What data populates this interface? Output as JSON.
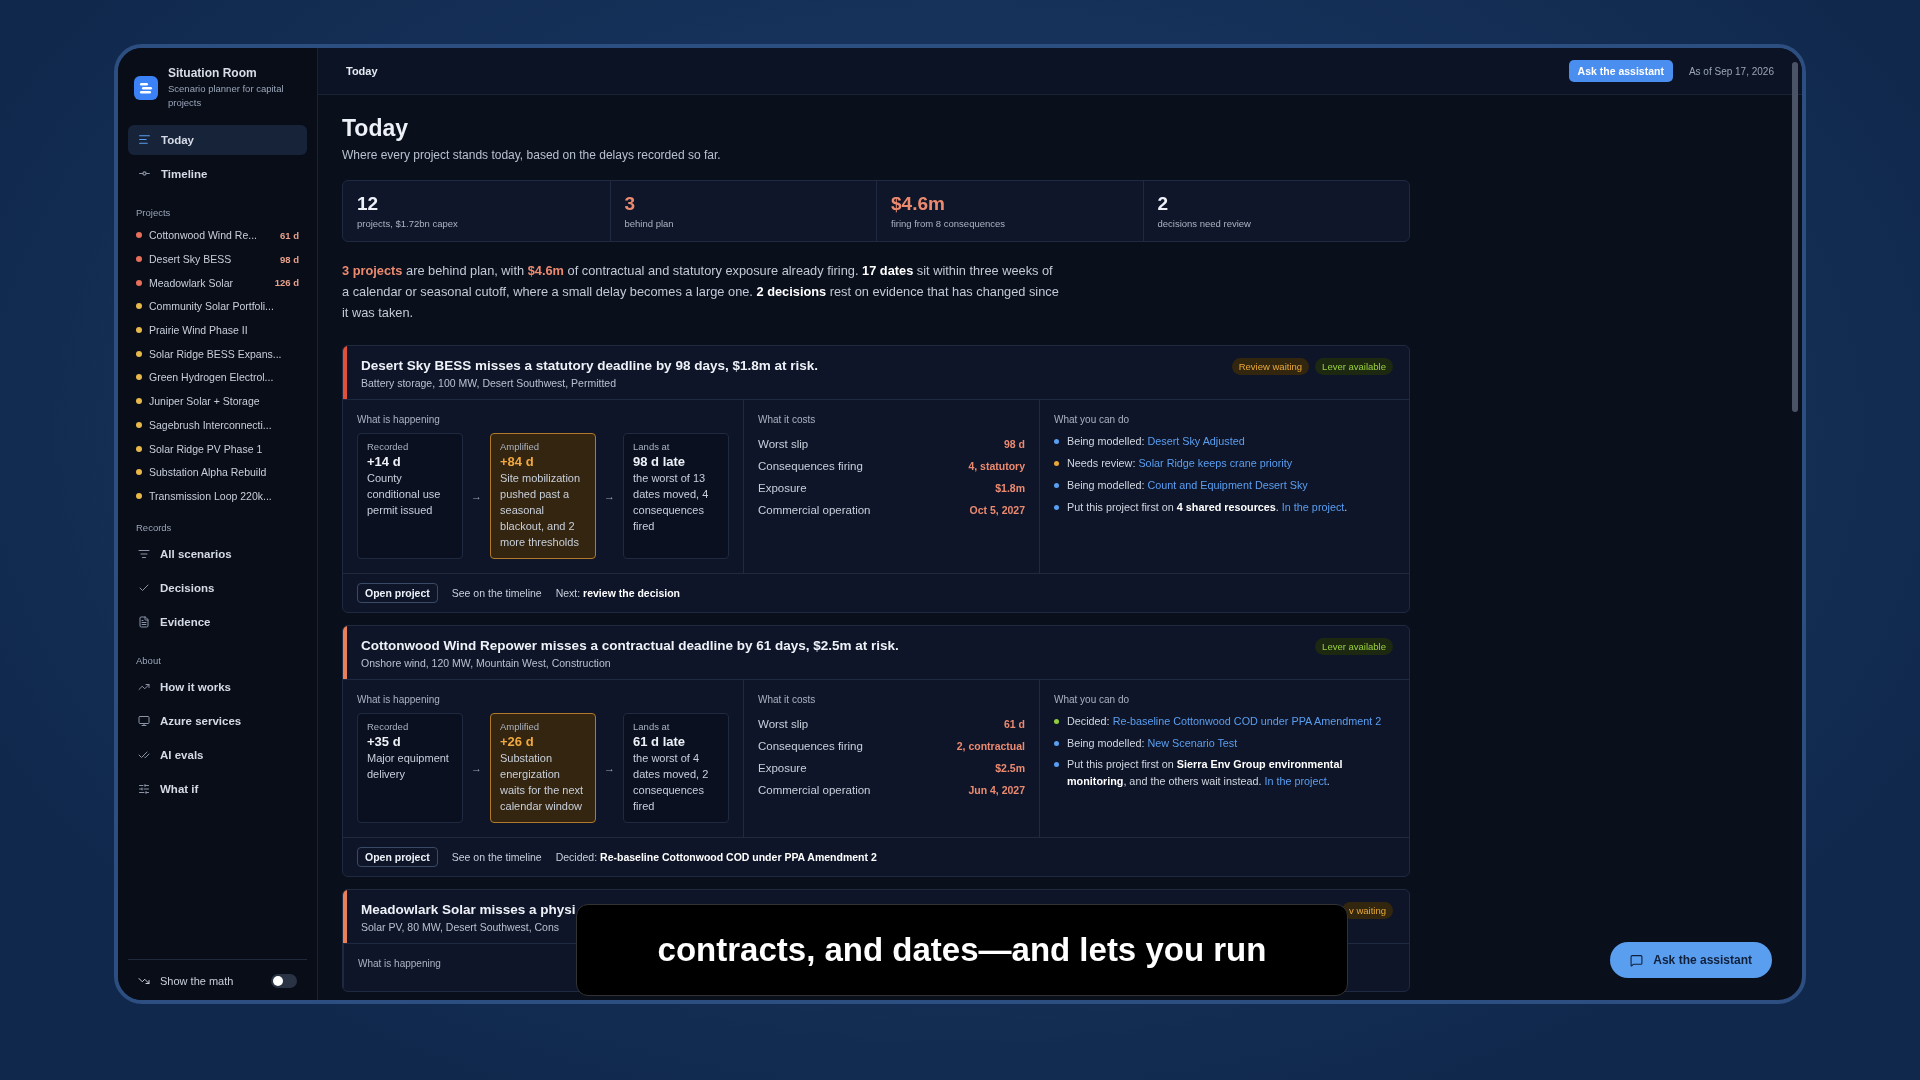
{
  "sidebar": {
    "brand": {
      "title": "Situation Room",
      "subtitle": "Scenario planner for capital projects"
    },
    "nav": [
      {
        "label": "Today",
        "selected": true
      },
      {
        "label": "Timeline",
        "selected": false
      }
    ],
    "groups": [
      {
        "heading": "Projects",
        "projects": [
          {
            "name": "Cottonwood Wind Re...",
            "days": "61 d",
            "color": "#e8705a"
          },
          {
            "name": "Desert Sky BESS",
            "days": "98 d",
            "color": "#e8705a"
          },
          {
            "name": "Meadowlark Solar",
            "days": "126 d",
            "color": "#e8705a"
          },
          {
            "name": "Community Solar Portfoli...",
            "color": "#e8b84a"
          },
          {
            "name": "Prairie Wind Phase II",
            "color": "#e8b84a"
          },
          {
            "name": "Solar Ridge BESS Expans...",
            "color": "#e8b84a"
          },
          {
            "name": "Green Hydrogen Electrol...",
            "color": "#e8b84a"
          },
          {
            "name": "Juniper Solar + Storage",
            "color": "#e8b84a"
          },
          {
            "name": "Sagebrush Interconnecti...",
            "color": "#e8b84a"
          },
          {
            "name": "Solar Ridge PV Phase 1",
            "color": "#e8b84a"
          },
          {
            "name": "Substation Alpha Rebuild",
            "color": "#e8b84a"
          },
          {
            "name": "Transmission Loop 220k...",
            "color": "#e8b84a"
          }
        ]
      },
      {
        "heading": "Records",
        "links": [
          "All scenarios",
          "Decisions",
          "Evidence"
        ]
      },
      {
        "heading": "About",
        "links": [
          "How it works",
          "Azure services",
          "AI evals",
          "What if"
        ]
      }
    ],
    "toggle": {
      "label": "Show the math",
      "on": false
    }
  },
  "topbar": {
    "title": "Today",
    "button": "Ask the assistant",
    "as_of": "As of Sep 17, 2026"
  },
  "heading": "Today",
  "subtitle": "Where every project stands today, based on the delays recorded so far.",
  "stats": [
    {
      "value": "12",
      "label": "projects, $1.72bn capex",
      "kind": "plain"
    },
    {
      "value": "3",
      "label": "behind plan",
      "kind": "alert"
    },
    {
      "value": "$4.6m",
      "label": "firing from 8 consequences",
      "kind": "alert"
    },
    {
      "value": "2",
      "label": "decisions need review",
      "kind": "plain"
    }
  ],
  "summary": [
    {
      "text": "3 projects",
      "kind": "alert"
    },
    {
      "text": " are behind plan, with ",
      "kind": "plain"
    },
    {
      "text": "$4.6m",
      "kind": "alert"
    },
    {
      "text": " of contractual and statutory exposure already firing. ",
      "kind": "plain"
    },
    {
      "text": "17 dates",
      "kind": "strong"
    },
    {
      "text": " sit within three weeks of a calendar or seasonal cutoff, where a small delay becomes a large one. ",
      "kind": "plain"
    },
    {
      "text": "2 decisions",
      "kind": "strong"
    },
    {
      "text": " rest on evidence that has changed since it was taken.",
      "kind": "plain"
    }
  ],
  "cards": [
    {
      "title": "Desert Sky BESS misses a statutory deadline by 98 days, $1.8m at risk.",
      "subtitle": "Battery storage, 100 MW, Desert Southwest, Permitted",
      "color": "#e0503a",
      "badges": [
        {
          "label": "Review waiting",
          "kind": "review"
        },
        {
          "label": "Lever available",
          "kind": "lever"
        }
      ],
      "happening": {
        "heading": "What is happening",
        "steps": [
          {
            "label": "Recorded",
            "value": "+14 d",
            "text": "County conditional use permit issued",
            "kind": "plain"
          },
          {
            "label": "Amplified",
            "value": "+84 d",
            "text": "Site mobilization pushed past a seasonal blackout, and 2 more thresholds",
            "kind": "amplified"
          },
          {
            "label": "Lands at",
            "value": "98 d late",
            "text": "the worst of 13 dates moved, 4 consequences fired",
            "kind": "plain"
          }
        ],
        "arrows": [
          "→",
          "→"
        ]
      },
      "costs": {
        "heading": "What it costs",
        "rows": [
          {
            "label": "Worst slip",
            "value": "98 d"
          },
          {
            "label": "Consequences firing",
            "value": "4, statutory"
          },
          {
            "label": "Exposure",
            "value": "$1.8m"
          },
          {
            "label": "Commercial operation",
            "value": "Oct 5, 2027"
          }
        ]
      },
      "actions": {
        "heading": "What you can do",
        "items": [
          {
            "color": "#5a9ef0",
            "parts": [
              {
                "text": "Being modelled: ",
                "kind": "plain"
              },
              {
                "text": "Desert Sky Adjusted",
                "kind": "link"
              }
            ]
          },
          {
            "color": "#e8a838",
            "parts": [
              {
                "text": "Needs review: ",
                "kind": "plain"
              },
              {
                "text": "Solar Ridge keeps crane priority",
                "kind": "link"
              }
            ]
          },
          {
            "color": "#5a9ef0",
            "parts": [
              {
                "text": "Being modelled: ",
                "kind": "plain"
              },
              {
                "text": "Count and Equipment Desert Sky",
                "kind": "link"
              }
            ]
          },
          {
            "color": "#5a9ef0",
            "parts": [
              {
                "text": "Put this project first on ",
                "kind": "plain"
              },
              {
                "text": "4 shared resources",
                "kind": "strong"
              },
              {
                "text": ". ",
                "kind": "plain"
              },
              {
                "text": "In the project",
                "kind": "link"
              },
              {
                "text": ".",
                "kind": "plain"
              }
            ]
          }
        ]
      },
      "footer": {
        "button": "Open project",
        "link": "See on the timeline",
        "note_label": "Next:",
        "note_value": "review the decision"
      }
    },
    {
      "title": "Cottonwood Wind Repower misses a contractual deadline by 61 days, $2.5m at risk.",
      "subtitle": "Onshore wind, 120 MW, Mountain West, Construction",
      "color": "#e8805a",
      "badges": [
        {
          "label": "Lever available",
          "kind": "lever"
        }
      ],
      "happening": {
        "heading": "What is happening",
        "steps": [
          {
            "label": "Recorded",
            "value": "+35 d",
            "text": "Major equipment delivery",
            "kind": "plain"
          },
          {
            "label": "Amplified",
            "value": "+26 d",
            "text": "Substation energization waits for the next calendar window",
            "kind": "amplified"
          },
          {
            "label": "Lands at",
            "value": "61 d late",
            "text": "the worst of 4 dates moved, 2 consequences fired",
            "kind": "plain"
          }
        ],
        "arrows": [
          "→",
          "→"
        ]
      },
      "costs": {
        "heading": "What it costs",
        "rows": [
          {
            "label": "Worst slip",
            "value": "61 d"
          },
          {
            "label": "Consequences firing",
            "value": "2, contractual"
          },
          {
            "label": "Exposure",
            "value": "$2.5m"
          },
          {
            "label": "Commercial operation",
            "value": "Jun 4, 2027"
          }
        ]
      },
      "actions": {
        "heading": "What you can do",
        "items": [
          {
            "color": "#8fcf3f",
            "parts": [
              {
                "text": "Decided: ",
                "kind": "plain"
              },
              {
                "text": "Re-baseline Cottonwood COD under PPA Amendment 2",
                "kind": "link"
              }
            ]
          },
          {
            "color": "#5a9ef0",
            "parts": [
              {
                "text": "Being modelled: ",
                "kind": "plain"
              },
              {
                "text": "New Scenario Test",
                "kind": "link"
              }
            ]
          },
          {
            "color": "#5a9ef0",
            "parts": [
              {
                "text": "Put this project first on ",
                "kind": "plain"
              },
              {
                "text": "Sierra Env Group environmental monitoring",
                "kind": "strong"
              },
              {
                "text": ", and the others wait instead. ",
                "kind": "plain"
              },
              {
                "text": "In the project",
                "kind": "link"
              },
              {
                "text": ".",
                "kind": "plain"
              }
            ]
          }
        ]
      },
      "footer": {
        "button": "Open project",
        "link": "See on the timeline",
        "note_label": "Decided:",
        "note_value": "Re-baseline Cottonwood COD under PPA Amendment 2"
      }
    }
  ],
  "partial_card": {
    "title": "Meadowlark Solar misses a physi",
    "subtitle": "Solar PV, 80 MW, Desert Southwest, Cons",
    "badge": "v waiting",
    "heading": "What is happening",
    "color": "#e8805a"
  },
  "caption": "contracts, and dates—and lets you run",
  "floating_button": "Ask the assistant"
}
